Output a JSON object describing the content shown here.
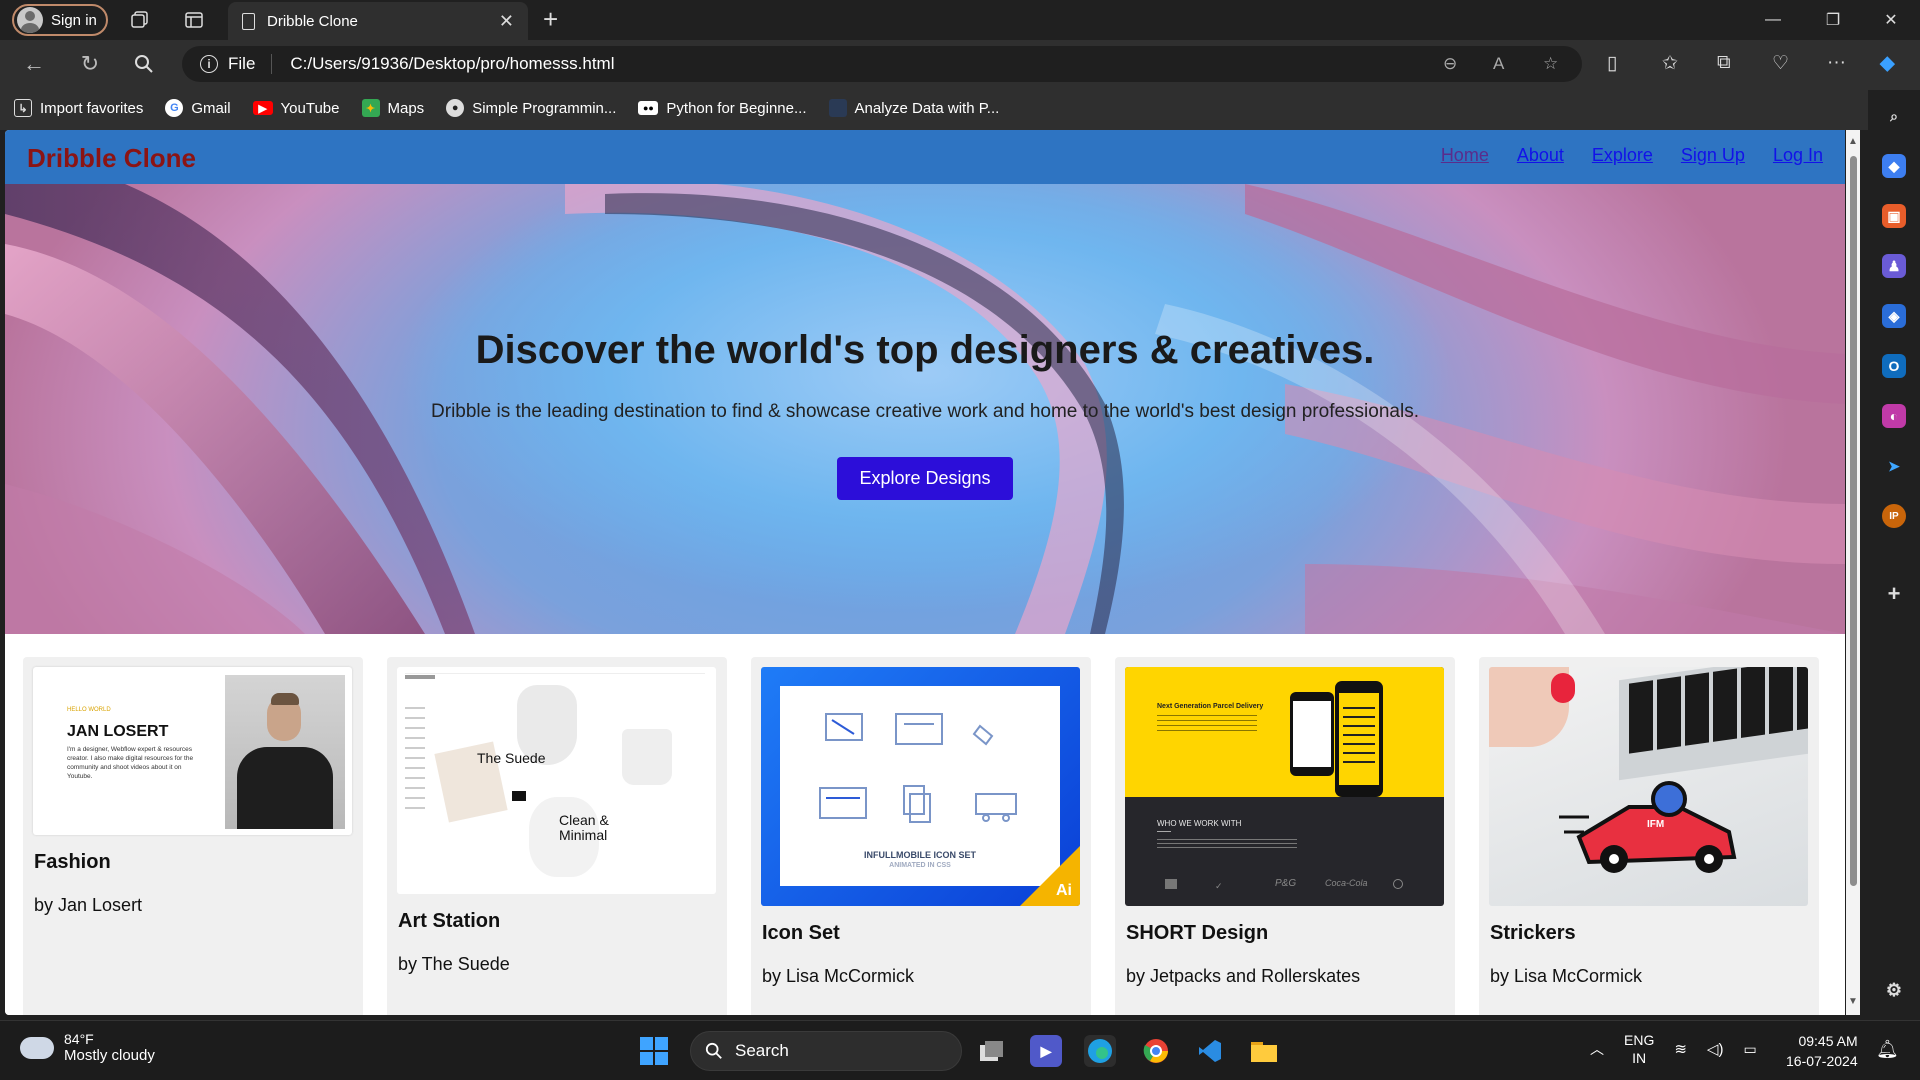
{
  "browser": {
    "profile_label": "Sign in",
    "tab_title": "Dribble Clone",
    "address_prefix": "File",
    "url": "C:/Users/91936/Desktop/pro/homesss.html"
  },
  "bookmarks": [
    {
      "label": "Import favorites",
      "icon": "import-icon"
    },
    {
      "label": "Gmail",
      "icon": "google-icon"
    },
    {
      "label": "YouTube",
      "icon": "youtube-icon"
    },
    {
      "label": "Maps",
      "icon": "maps-icon"
    },
    {
      "label": "Simple Programmin...",
      "icon": "github-icon"
    },
    {
      "label": "Python for Beginne...",
      "icon": "video-icon"
    },
    {
      "label": "Analyze Data with P...",
      "icon": "page-icon"
    }
  ],
  "site": {
    "logo": "Dribble Clone",
    "nav": [
      "Home",
      "About",
      "Explore",
      "Sign Up",
      "Log In"
    ]
  },
  "hero": {
    "title": "Discover the world's top designers & creatives.",
    "subtitle": "Dribble is the leading destination to find & showcase creative work and home to the world's best design professionals.",
    "button": "Explore Designs"
  },
  "cards": [
    {
      "name": "Fashion",
      "by": "by Jan Losert",
      "thumb_text": "JAN LOSERT",
      "thumb_sub": "I'm a designer, Webflow expert & resources creator. I also make digital resources for the community and shoot videos about it on Youtube."
    },
    {
      "name": "Art Station",
      "by": "by The Suede",
      "thumb_text": "The Suede",
      "thumb_sub": "Clean & Minimal"
    },
    {
      "name": "Icon Set",
      "by": "by Lisa McCormick",
      "thumb_text": "INFULLMOBILE ICON SET",
      "thumb_sub": "ANIMATED IN CSS",
      "badge": "Ai"
    },
    {
      "name": "SHORT Design",
      "by": "by Jetpacks and Rollerskates",
      "thumb_text": "Next Generation Parcel Delivery",
      "thumb_sub": "WHO WE WORK WITH",
      "logos": [
        "P&G",
        "Coca-Cola"
      ]
    },
    {
      "name": "Strickers",
      "by": "by Lisa McCormick",
      "thumb_text": "IFM"
    }
  ],
  "taskbar": {
    "temp": "84°F",
    "condition": "Mostly cloudy",
    "search_placeholder": "Search",
    "lang_top": "ENG",
    "lang_bottom": "IN",
    "time": "09:45 AM",
    "date": "16-07-2024"
  },
  "colors": {
    "header_bg": "#2e74c2",
    "logo": "#8b1414",
    "button": "#2c0ed9"
  }
}
